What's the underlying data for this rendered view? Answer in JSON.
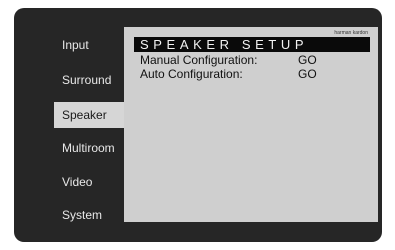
{
  "sidebar": {
    "items": [
      {
        "label": "Input"
      },
      {
        "label": "Surround"
      },
      {
        "label": "Speaker"
      },
      {
        "label": "Multiroom"
      },
      {
        "label": "Video"
      },
      {
        "label": "System"
      }
    ],
    "selected": "Speaker"
  },
  "panel": {
    "brand": "harman kardon",
    "title": "SPEAKER SETUP",
    "rows": [
      {
        "label": "Manual Configuration:",
        "value": "GO"
      },
      {
        "label": "Auto Configuration:",
        "value": "GO"
      }
    ]
  }
}
